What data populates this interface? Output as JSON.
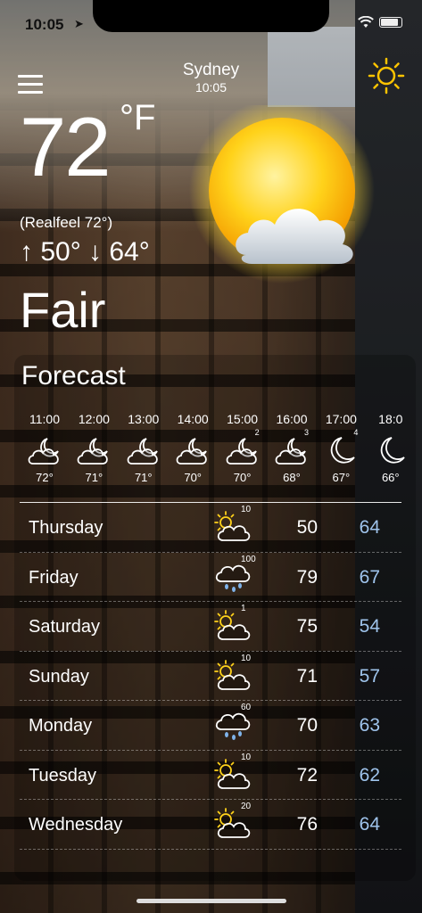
{
  "status_bar": {
    "time": "10:05",
    "location_arrow": "➤"
  },
  "header": {
    "city": "Sydney",
    "local_time": "10:05",
    "menu_icon": "hamburger-menu-icon",
    "weather_icon": "sun-icon"
  },
  "current": {
    "temperature": "72",
    "unit": "°F",
    "realfeel": "(Realfeel 72°)",
    "high_low": "↑ 50° ↓ 64°",
    "condition": "Fair",
    "icon": "sun-with-cloud-icon"
  },
  "forecast": {
    "title": "Forecast",
    "hourly": [
      {
        "time": "11:00",
        "icon": "partly-cloudy-night-icon",
        "precip": "",
        "temp": "72°"
      },
      {
        "time": "12:00",
        "icon": "partly-cloudy-night-icon",
        "precip": "",
        "temp": "71°"
      },
      {
        "time": "13:00",
        "icon": "partly-cloudy-night-icon",
        "precip": "",
        "temp": "71°"
      },
      {
        "time": "14:00",
        "icon": "partly-cloudy-night-icon",
        "precip": "",
        "temp": "70°"
      },
      {
        "time": "15:00",
        "icon": "partly-cloudy-night-icon",
        "precip": "2",
        "temp": "70°"
      },
      {
        "time": "16:00",
        "icon": "partly-cloudy-night-icon",
        "precip": "3",
        "temp": "68°"
      },
      {
        "time": "17:00",
        "icon": "moon-icon",
        "precip": "4",
        "temp": "67°"
      },
      {
        "time": "18:0",
        "icon": "moon-icon",
        "precip": "",
        "temp": "66°"
      }
    ],
    "daily": [
      {
        "day": "Thursday",
        "icon": "partly-cloudy-day-icon",
        "precip": "10",
        "high": "50",
        "low": "64"
      },
      {
        "day": "Friday",
        "icon": "rain-cloud-icon",
        "precip": "100",
        "high": "79",
        "low": "67"
      },
      {
        "day": "Saturday",
        "icon": "partly-cloudy-day-icon",
        "precip": "1",
        "high": "75",
        "low": "54"
      },
      {
        "day": "Sunday",
        "icon": "partly-cloudy-day-icon",
        "precip": "10",
        "high": "71",
        "low": "57"
      },
      {
        "day": "Monday",
        "icon": "rain-cloud-icon",
        "precip": "60",
        "high": "70",
        "low": "63"
      },
      {
        "day": "Tuesday",
        "icon": "partly-cloudy-day-icon",
        "precip": "10",
        "high": "72",
        "low": "62"
      },
      {
        "day": "Wednesday",
        "icon": "partly-cloudy-day-icon",
        "precip": "20",
        "high": "76",
        "low": "64"
      }
    ]
  },
  "colors": {
    "low_temp": "#9fc4ec",
    "sun": "#ffc400"
  }
}
